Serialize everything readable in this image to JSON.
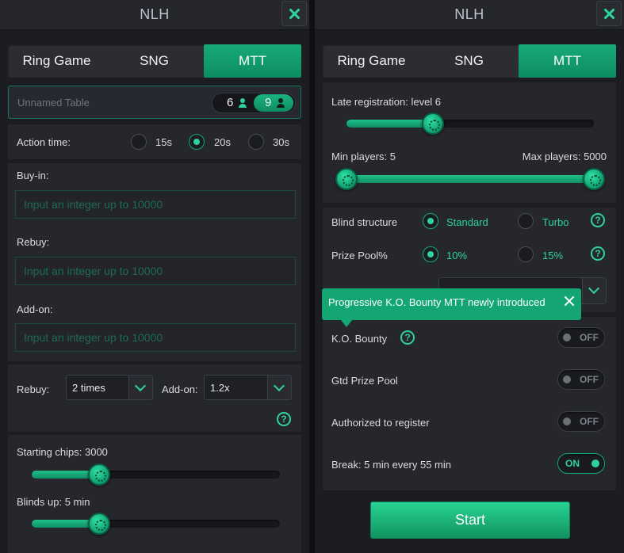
{
  "colors": {
    "accent": "#2fd29a",
    "accent_dark": "#0f8c62",
    "panel_bg": "#1c1d22",
    "section_bg": "#26272c"
  },
  "left": {
    "title": "NLH",
    "tabs": [
      {
        "label": "Ring Game"
      },
      {
        "label": "SNG"
      },
      {
        "label": "MTT",
        "active": true
      }
    ],
    "table_name": {
      "placeholder": "Unnamed Table",
      "value": ""
    },
    "seats": {
      "options": [
        "6",
        "9"
      ],
      "selected": "9"
    },
    "action_time": {
      "label": "Action time:",
      "options": [
        "15s",
        "20s",
        "30s"
      ],
      "selected": "20s"
    },
    "buy_in": {
      "label": "Buy-in:",
      "placeholder": "Input an integer up to 10000"
    },
    "rebuy": {
      "label": "Rebuy:",
      "placeholder": "Input an integer up to 10000"
    },
    "add_on": {
      "label": "Add-on:",
      "placeholder": "Input an integer up to 10000"
    },
    "rebuy_select": {
      "label": "Rebuy:",
      "value": "2 times"
    },
    "add_on_select": {
      "label": "Add-on:",
      "value": "1.2x"
    },
    "help": "?",
    "starting_chips": {
      "label": "Starting chips: 3000",
      "fraction": 0.27
    },
    "blinds_up": {
      "label": "Blinds up: 5 min",
      "fraction": 0.27
    }
  },
  "right": {
    "title": "NLH",
    "tabs": [
      {
        "label": "Ring Game"
      },
      {
        "label": "SNG"
      },
      {
        "label": "MTT",
        "active": true
      }
    ],
    "late_registration": {
      "label": "Late registration: level 6",
      "fraction": 0.35
    },
    "players": {
      "min_label": "Min players: 5",
      "max_label": "Max players: 5000",
      "min_fraction": 0.0,
      "max_fraction": 1.0
    },
    "blind_structure": {
      "label": "Blind structure",
      "options": [
        "Standard",
        "Turbo"
      ],
      "selected": "Standard"
    },
    "prize_pool": {
      "label": "Prize Pool%",
      "options": [
        "10%",
        "15%"
      ],
      "selected": "10%"
    },
    "tooltip": "Progressive K.O. Bounty MTT newly introduced",
    "ko_bounty": {
      "label": "K.O. Bounty",
      "state": "OFF"
    },
    "gtd_prize_pool": {
      "label": "Gtd Prize Pool",
      "state": "OFF"
    },
    "authorized": {
      "label": "Authorized to register",
      "state": "OFF"
    },
    "break": {
      "label": "Break: 5 min every 55 min",
      "state": "ON"
    },
    "help": "?",
    "start_label": "Start"
  }
}
